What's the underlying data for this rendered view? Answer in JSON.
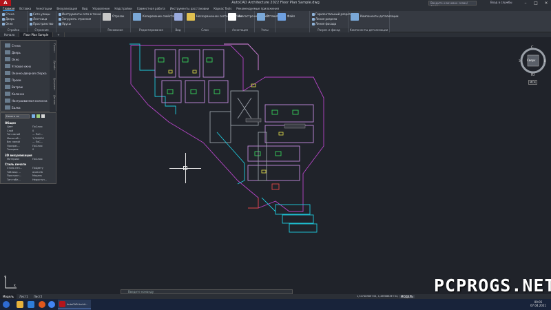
{
  "window": {
    "app_logo": "A",
    "title": "AutoCAD Architecture 2022   Floor Plan Sample.dwg",
    "search_placeholder": "Введите ключевое слово/фразу",
    "user": "Вход в службы"
  },
  "menu": [
    "Главная",
    "Вставка",
    "Аннотации",
    "Визуализация",
    "Вид",
    "Управление",
    "Надстройки",
    "Совместная работа",
    "Инструменты расстановки",
    "Каркас Tools",
    "Рекомендуемые приложения"
  ],
  "ribbon": {
    "panels": [
      {
        "title": "Стройка",
        "items": [
          "Стена",
          "Дверь",
          "Окно"
        ]
      },
      {
        "title": "Строения",
        "items": [
          "Сетк.улицы",
          "Лестница",
          "Пространство"
        ]
      },
      {
        "title": "",
        "items": [
          "Инструменты сети в точке",
          "Загрузить строения",
          "Ярусы"
        ]
      },
      {
        "title": "Рисование",
        "items": [
          "Отрезок"
        ]
      },
      {
        "title": "Редактирование",
        "items": [
          "Копирование свойств"
        ]
      },
      {
        "title": "Вид",
        "items": []
      },
      {
        "title": "Слои",
        "items": [
          "Несохраненное состояние слоя"
        ]
      },
      {
        "title": "Аннотация",
        "items": [
          "Многострочный текст"
        ]
      },
      {
        "title": "Узлы",
        "items": [
          "Вставить"
        ]
      },
      {
        "title": "",
        "items": [
          "Файл"
        ]
      },
      {
        "title": "Разрез и фасад",
        "items": [
          "Горизонтальный разрез",
          "Линия разреза",
          "Линия фасада"
        ]
      },
      {
        "title": "Компоненты детализации",
        "items": [
          "Компоненты детализации"
        ]
      }
    ]
  },
  "doc_tabs": [
    "Начало",
    "Floor Plan Sample"
  ],
  "tool_palette": {
    "items": [
      "Стена",
      "Дверь",
      "Окно",
      "Угловое окно",
      "Оконно-дверная сборка",
      "Проем",
      "Витраж",
      "Колонна",
      "Настраиваемая колонна",
      "Балка"
    ],
    "vtabs": [
      "Проект",
      "Дизайн",
      "Документ",
      "Детали"
    ]
  },
  "properties": {
    "selector": "Ничего не выбрано",
    "sections": [
      {
        "title": "Общее",
        "rows": [
          [
            "Цвет",
            "ПоСлою"
          ],
          [
            "Слой",
            "0"
          ],
          [
            "Тип линий",
            "— ПоС..."
          ],
          [
            "Масштаб...",
            "1,000000"
          ],
          [
            "Вес линий",
            "— ПоС..."
          ],
          [
            "Прозрач...",
            "ПоСлою"
          ],
          [
            "Толщина",
            "0"
          ]
        ]
      },
      {
        "title": "3D визуализация",
        "rows": [
          [
            "Материал",
            "ПоСлою"
          ]
        ]
      },
      {
        "title": "Стиль печати",
        "rows": [
          [
            "Стиль печ...",
            "ПоЦвету"
          ],
          [
            "Таблица ...",
            "acad.ctb"
          ],
          [
            "Простран...",
            "Модель"
          ],
          [
            "Тип табл...",
            "Недоступ..."
          ]
        ]
      }
    ]
  },
  "viewcube": {
    "top": "С",
    "face": "Сверх",
    "bottom": "Ю",
    "west": "З",
    "east": "В",
    "ucs": "МСК"
  },
  "command_placeholder": "Введите команду",
  "status": {
    "tabs": [
      "Модель",
      "Лист1",
      "Лист2"
    ],
    "coords": "1,5474838E+04, 1,4690883E+04, 0,0000",
    "mode": "МОДЕЛЬ"
  },
  "watermark": "PCPROGS.NET",
  "taskbar": {
    "app_label": "AutoCAD Archit...",
    "time": "09:05",
    "date": "07.04.2021"
  }
}
